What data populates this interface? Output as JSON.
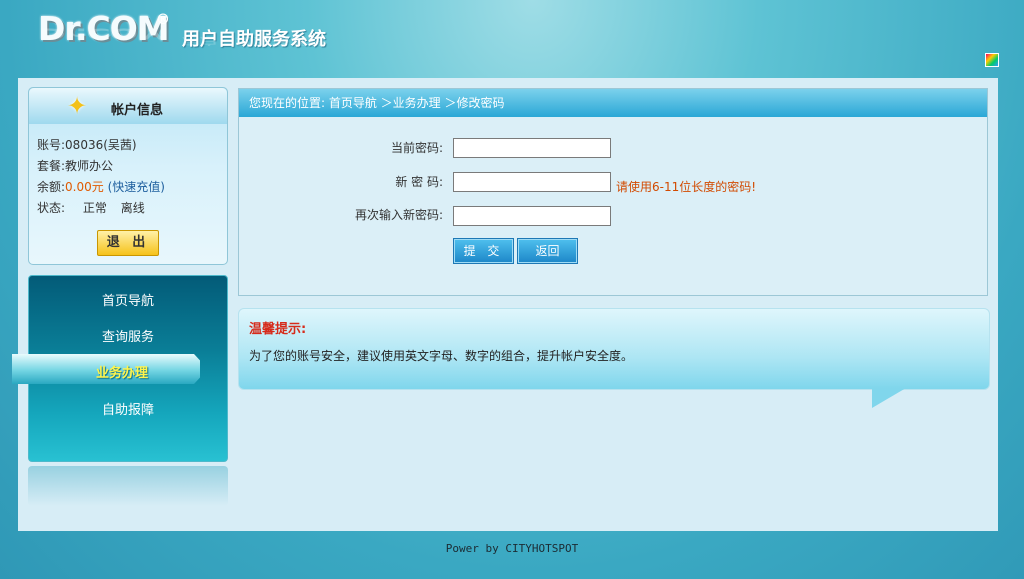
{
  "header": {
    "logo": "Dr.COM",
    "logo_mark": "®",
    "system_title": "用户自助服务系统"
  },
  "account": {
    "title": "帐户信息",
    "account_label": "账号:",
    "account_value": "08036(吴茜)",
    "plan_label": "套餐:",
    "plan_value": "教师办公",
    "balance_label": "余额:",
    "balance_value": "0.00元",
    "recharge_link": "(快速充值)",
    "status_label": "状态:",
    "status_value": "正常",
    "status_online": "离线",
    "logout_label": "退 出"
  },
  "nav": {
    "items": [
      "首页导航",
      "查询服务",
      "业务办理",
      "自助报障"
    ],
    "active_index": 2
  },
  "breadcrumb": {
    "text": "您现在的位置: 首页导航 ＞业务办理 ＞修改密码"
  },
  "form": {
    "current_label": "当前密码:",
    "new_label": "新 密 码:",
    "confirm_label": "再次输入新密码:",
    "current_value": "",
    "new_value": "",
    "confirm_value": "",
    "hint": "请使用6-11位长度的密码!",
    "submit_label": "提 交",
    "back_label": "返回"
  },
  "tip": {
    "title": "温馨提示:",
    "text": "为了您的账号安全，建议使用英文字母、数字的组合，提升帐户安全度。"
  },
  "footer": {
    "text": "Power by CITYHOTSPOT"
  },
  "colors": {
    "accent": "#2aa7d6",
    "nav_dark": "#035b78",
    "warning": "#d24a00",
    "tip_title": "#d62b1b",
    "active_nav_text": "#fff44c"
  }
}
